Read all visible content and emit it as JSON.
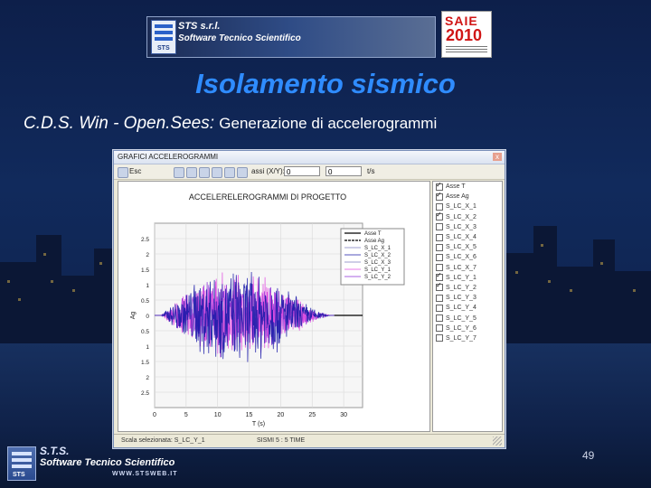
{
  "header": {
    "company_name": "STS s.r.l.",
    "company_tagline": "Software Tecnico Scientifico",
    "logo_text": "STS",
    "event_logo_top": "SAIE",
    "event_logo_year": "2010"
  },
  "slide": {
    "title": "Isolamento sismico",
    "subtitle_program": "C.D.S. Win - Open.Sees:",
    "subtitle_text": "Generazione di accelerogrammi",
    "page_number": "49"
  },
  "footer": {
    "logo_text": "STS",
    "line1": "S.T.S.",
    "line2": "Software Tecnico Scientifico",
    "line3": "WWW.STSWEB.IT"
  },
  "window": {
    "title": "GRAFICI ACCELEROGRAMMI",
    "close_label": "x",
    "toolbar": {
      "esc_label": "Esc",
      "assi_label": "assi (X/Y):",
      "x_value": "0",
      "y_value": "0",
      "extra_label": "t/s"
    },
    "statusbar": {
      "left_text": "Scala selezionata: S_LC_Y_1",
      "mid_text": "SISMI 5 : 5 TIME"
    },
    "checklist": [
      {
        "label": "Asse T",
        "checked": true
      },
      {
        "label": "Asse Ag",
        "checked": true
      },
      {
        "label": "S_LC_X_1",
        "checked": false
      },
      {
        "label": "S_LC_X_2",
        "checked": true
      },
      {
        "label": "S_LC_X_3",
        "checked": false
      },
      {
        "label": "S_LC_X_4",
        "checked": false
      },
      {
        "label": "S_LC_X_5",
        "checked": false
      },
      {
        "label": "S_LC_X_6",
        "checked": false
      },
      {
        "label": "S_LC_X_7",
        "checked": false
      },
      {
        "label": "S_LC_Y_1",
        "checked": true
      },
      {
        "label": "S_LC_Y_2",
        "checked": true
      },
      {
        "label": "S_LC_Y_3",
        "checked": false
      },
      {
        "label": "S_LC_Y_4",
        "checked": false
      },
      {
        "label": "S_LC_Y_5",
        "checked": false
      },
      {
        "label": "S_LC_Y_6",
        "checked": false
      },
      {
        "label": "S_LC_Y_7",
        "checked": false
      }
    ]
  },
  "chart_data": {
    "type": "line",
    "title": "ACCELERELEROGRAMMI DI PROGETTO",
    "xlabel": "T (s)",
    "ylabel": "Ag",
    "xlim": [
      0,
      33
    ],
    "ylim": [
      -3,
      3
    ],
    "x_ticks": [
      "0",
      "5",
      "10",
      "15",
      "20",
      "25",
      "30"
    ],
    "y_ticks": [
      "2.5",
      "2",
      "1.5",
      "1",
      "0.5",
      "0",
      "0.5",
      "1",
      "1.5",
      "2",
      "2.5"
    ],
    "legend_position": "top-right",
    "legend": [
      "Asse T",
      "Asse Ag",
      "S_LC_X_1",
      "S_LC_X_2",
      "S_LC_X_3",
      "S_LC_Y_1",
      "S_LC_Y_2"
    ],
    "series": [
      {
        "name": "S_LC_X_2",
        "color": "#1a1aa8",
        "envelope": {
          "t_start": 1,
          "t_peak_start": 8,
          "t_peak_end": 18,
          "t_end": 28,
          "peak_amplitude": 1.6
        }
      },
      {
        "name": "S_LC_Y_1",
        "color": "#e04ce0",
        "envelope": {
          "t_start": 1,
          "t_peak_start": 8,
          "t_peak_end": 18,
          "t_end": 28,
          "peak_amplitude": 1.4
        }
      },
      {
        "name": "S_LC_Y_2",
        "color": "#8b2bd8",
        "envelope": {
          "t_start": 1,
          "t_peak_start": 8,
          "t_peak_end": 18,
          "t_end": 28,
          "peak_amplitude": 1.2
        }
      }
    ],
    "colors": {
      "axis": "#000000",
      "grid": "#d8d8d8",
      "baseline_after": "#000000"
    }
  }
}
